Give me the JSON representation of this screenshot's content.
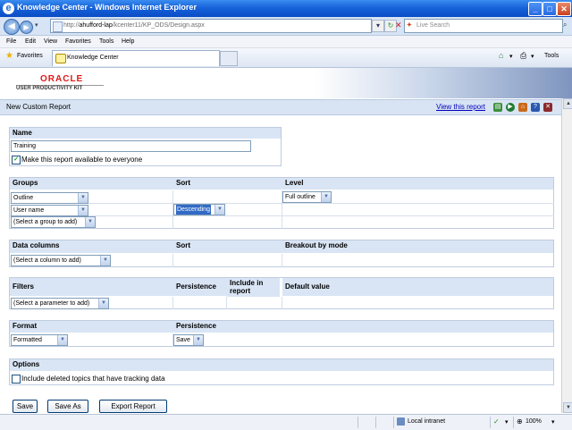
{
  "window": {
    "title": "Knowledge Center - Windows Internet Explorer",
    "min": "_",
    "max": "□",
    "close": "✕"
  },
  "address": {
    "url_prefix": "http://",
    "host": "ahufford-lap",
    "path": "/kcenter11/KP_ODS/Design.aspx"
  },
  "search": {
    "placeholder": "Live Search"
  },
  "menu": [
    "File",
    "Edit",
    "View",
    "Favorites",
    "Tools",
    "Help"
  ],
  "favorites": {
    "label": "Favorites",
    "tab": "Knowledge Center",
    "tools": "Tools"
  },
  "brand": {
    "oracle": "ORACLE",
    "product": "USER PRODUCTIVITY KIT"
  },
  "page": {
    "title": "New Custom Report",
    "view_link": "View this report"
  },
  "name_section": {
    "header": "Name",
    "value": "Training",
    "share_label": "Make this report available to everyone",
    "share_checked": true
  },
  "groups_section": {
    "headers": {
      "groups": "Groups",
      "sort": "Sort",
      "level": "Level"
    },
    "rows": [
      {
        "group": "Outline",
        "sort": "",
        "level": "Full outline"
      },
      {
        "group": "User name",
        "sort": "Descending",
        "level": ""
      },
      {
        "group": "(Select a group to add)",
        "sort": "",
        "level": ""
      }
    ]
  },
  "data_section": {
    "headers": {
      "columns": "Data columns",
      "sort": "Sort",
      "breakout": "Breakout by mode"
    },
    "select": "(Select a column to add)"
  },
  "filters_section": {
    "headers": {
      "filters": "Filters",
      "persistence": "Persistence",
      "include": "Include in report",
      "default": "Default value"
    },
    "select": "(Select a parameter to add)"
  },
  "format_section": {
    "headers": {
      "format": "Format",
      "persistence": "Persistence"
    },
    "format": "Formatted",
    "persistence": "Save"
  },
  "options_section": {
    "header": "Options",
    "deleted_label": "Include deleted topics that have tracking data",
    "deleted_checked": false
  },
  "buttons": {
    "save": "Save",
    "save_as": "Save As",
    "export": "Export Report"
  },
  "status": {
    "zone": "Local intranet",
    "zoom": "100%"
  },
  "icons": [
    "ie-icon",
    "back-icon",
    "forward-icon",
    "refresh-icon",
    "stop-icon",
    "search-icon",
    "favorites-star-icon",
    "home-icon",
    "print-icon",
    "help-icon"
  ]
}
